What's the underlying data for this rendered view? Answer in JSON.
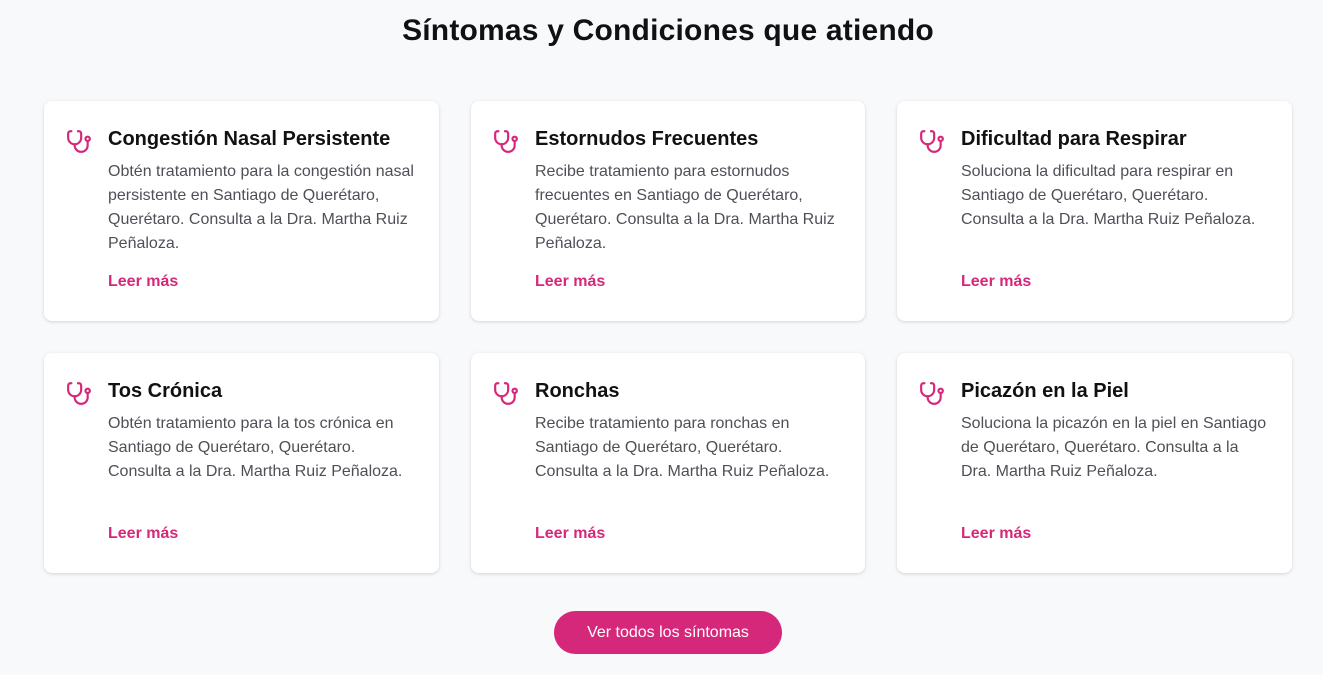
{
  "section": {
    "title": "Síntomas y Condiciones que atiendo"
  },
  "theme": {
    "accent": "#d6287a",
    "background": "#f8f9fb",
    "card": "#ffffff"
  },
  "cards": [
    {
      "icon": "stethoscope-icon",
      "title": "Congestión Nasal Persistente",
      "description": "Obtén tratamiento para la congestión nasal persistente en Santiago de Querétaro, Querétaro. Consulta a la Dra. Martha Ruiz Peñaloza.",
      "link": "Leer más"
    },
    {
      "icon": "stethoscope-icon",
      "title": "Estornudos Frecuentes",
      "description": "Recibe tratamiento para estornudos frecuentes en Santiago de Querétaro, Querétaro. Consulta a la Dra. Martha Ruiz Peñaloza.",
      "link": "Leer más"
    },
    {
      "icon": "stethoscope-icon",
      "title": "Dificultad para Respirar",
      "description": "Soluciona la dificultad para respirar en Santiago de Querétaro, Querétaro. Consulta a la Dra. Martha Ruiz Peñaloza.",
      "link": "Leer más"
    },
    {
      "icon": "stethoscope-icon",
      "title": "Tos Crónica",
      "description": "Obtén tratamiento para la tos crónica en Santiago de Querétaro, Querétaro. Consulta a la Dra. Martha Ruiz Peñaloza.",
      "link": "Leer más"
    },
    {
      "icon": "stethoscope-icon",
      "title": "Ronchas",
      "description": "Recibe tratamiento para ronchas en Santiago de Querétaro, Querétaro. Consulta a la Dra. Martha Ruiz Peñaloza.",
      "link": "Leer más"
    },
    {
      "icon": "stethoscope-icon",
      "title": "Picazón en la Piel",
      "description": "Soluciona la picazón en la piel en Santiago de Querétaro, Querétaro. Consulta a la Dra. Martha Ruiz Peñaloza.",
      "link": "Leer más"
    }
  ],
  "cta": {
    "label": "Ver todos los síntomas"
  }
}
